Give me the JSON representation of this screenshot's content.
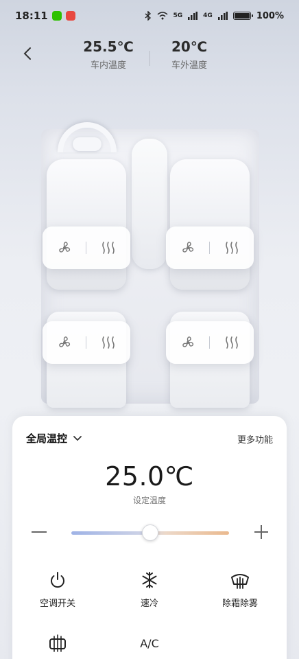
{
  "status_bar": {
    "time": "18:11",
    "network": "5G",
    "network2": "4G",
    "battery": "100%"
  },
  "header": {
    "inside_temp": "25.5℃",
    "inside_label": "车内温度",
    "outside_temp": "20℃",
    "outside_label": "车外温度"
  },
  "seats": [
    {
      "position": "front-left",
      "fan_icon": "fan-icon",
      "heat_icon": "seat-heat-icon"
    },
    {
      "position": "front-right",
      "fan_icon": "fan-icon",
      "heat_icon": "seat-heat-icon"
    },
    {
      "position": "rear-left",
      "fan_icon": "fan-icon",
      "heat_icon": "seat-heat-icon"
    },
    {
      "position": "rear-right",
      "fan_icon": "fan-icon",
      "heat_icon": "seat-heat-icon"
    }
  ],
  "panel": {
    "title": "全局温控",
    "more": "更多功能",
    "set_temp": "25.0℃",
    "set_temp_label": "设定温度",
    "slider_value_percent": 50,
    "functions": [
      {
        "label": "空调开关",
        "icon": "power-icon"
      },
      {
        "label": "速冷",
        "icon": "snowflake-icon"
      },
      {
        "label": "除霜除雾",
        "icon": "defrost-icon"
      },
      {
        "label": "",
        "icon": "rear-defrost-icon"
      },
      {
        "label": "A/C",
        "icon": "ac-text"
      }
    ]
  },
  "colors": {
    "slider_cool": "#9fb3e6",
    "slider_warm": "#eab98e",
    "wechat": "#2dc100",
    "app_red": "#e8483f"
  }
}
